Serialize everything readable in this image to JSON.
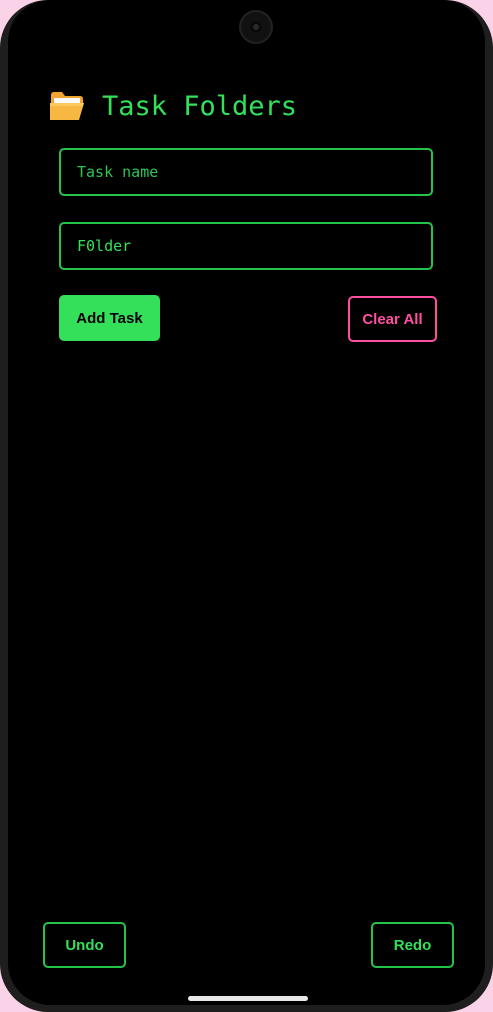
{
  "header": {
    "icon": "open-folder-icon",
    "title": "Task Folders"
  },
  "form": {
    "task_name_placeholder": "Task name",
    "task_name_value": "",
    "folder_placeholder": "",
    "folder_value": "F0lder",
    "add_label": "Add Task",
    "clear_label": "Clear All"
  },
  "footer": {
    "undo_label": "Undo",
    "redo_label": "Redo"
  },
  "colors": {
    "accent_green": "#34e05a",
    "accent_pink": "#ff4fa3",
    "background": "#000000"
  }
}
